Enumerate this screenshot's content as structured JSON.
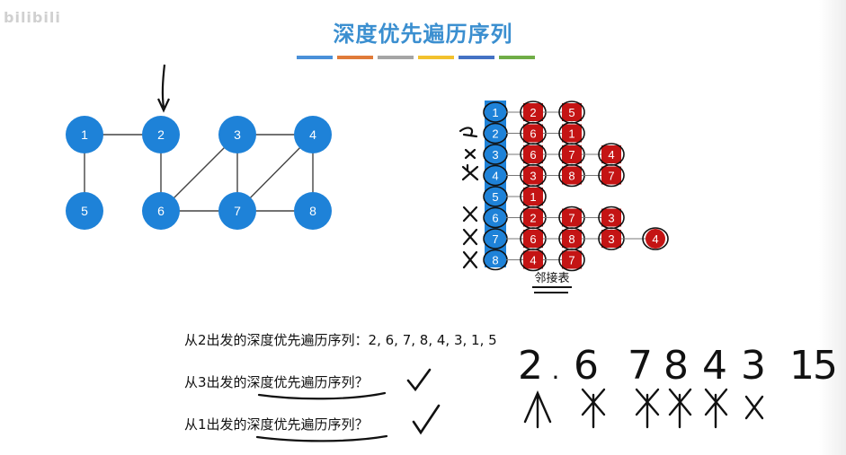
{
  "watermark": "bilibili",
  "title": "深度优先遍历序列",
  "color_bar": [
    "#4a90d9",
    "#e07b39",
    "#a5a5a5",
    "#f2c12e",
    "#4472c4",
    "#70ad47"
  ],
  "colors": {
    "node_blue": "#1e82d8",
    "cell_red": "#c41414",
    "edge_gray": "#444444"
  },
  "graph": {
    "nodes": [
      {
        "id": "1",
        "label": "1"
      },
      {
        "id": "2",
        "label": "2"
      },
      {
        "id": "3",
        "label": "3"
      },
      {
        "id": "4",
        "label": "4"
      },
      {
        "id": "5",
        "label": "5"
      },
      {
        "id": "6",
        "label": "6"
      },
      {
        "id": "7",
        "label": "7"
      },
      {
        "id": "8",
        "label": "8"
      }
    ],
    "edges": [
      [
        "1",
        "2"
      ],
      [
        "1",
        "5"
      ],
      [
        "2",
        "6"
      ],
      [
        "3",
        "4"
      ],
      [
        "3",
        "6"
      ],
      [
        "3",
        "7"
      ],
      [
        "4",
        "7"
      ],
      [
        "4",
        "8"
      ],
      [
        "6",
        "7"
      ],
      [
        "7",
        "8"
      ]
    ]
  },
  "adjacency_list": {
    "caption": "邻接表",
    "rows": [
      {
        "head": "1",
        "items": [
          "2",
          "5"
        ]
      },
      {
        "head": "2",
        "items": [
          "6",
          "1"
        ]
      },
      {
        "head": "3",
        "items": [
          "6",
          "7",
          "4"
        ]
      },
      {
        "head": "4",
        "items": [
          "3",
          "8",
          "7"
        ]
      },
      {
        "head": "5",
        "items": [
          "1"
        ]
      },
      {
        "head": "6",
        "items": [
          "2",
          "7",
          "3"
        ]
      },
      {
        "head": "7",
        "items": [
          "6",
          "8",
          "3",
          "4"
        ]
      },
      {
        "head": "8",
        "items": [
          "4",
          "7"
        ]
      }
    ]
  },
  "questions": {
    "q1_prefix": "从2出发的深度优先遍历序列：",
    "q1_answer": "2, 6, 7, 8, 4, 3, 1, 5",
    "q2_prefix": "从3出发的",
    "q2_highlight": "深度优先遍历序列",
    "q2_suffix": "？",
    "q3_prefix": "从1出发的",
    "q3_highlight": "深度优先遍历序列",
    "q3_suffix": "？"
  },
  "handwriting": {
    "sequence": [
      "2",
      ".",
      "6",
      "7",
      "8",
      "4",
      "3",
      "1",
      "5"
    ]
  }
}
